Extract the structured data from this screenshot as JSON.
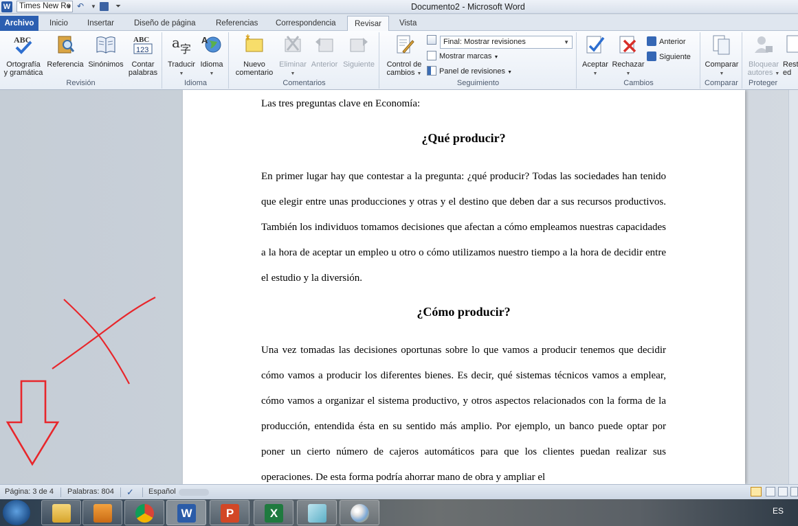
{
  "app": {
    "font_name": "Times New Ro",
    "window_title": "Documento2 - Microsoft Word"
  },
  "tabs": [
    {
      "label": "Archivo"
    },
    {
      "label": "Inicio"
    },
    {
      "label": "Insertar"
    },
    {
      "label": "Diseño de página"
    },
    {
      "label": "Referencias"
    },
    {
      "label": "Correspondencia"
    },
    {
      "label": "Revisar"
    },
    {
      "label": "Vista"
    }
  ],
  "active_tab": "Revisar",
  "ribbon": {
    "revision": {
      "label": "Revisión",
      "ortografia_1": "Ortografía",
      "ortografia_2": "y gramática",
      "referencia": "Referencia",
      "sinonimos": "Sinónimos",
      "contar_1": "Contar",
      "contar_2": "palabras"
    },
    "idioma": {
      "label": "Idioma",
      "traducir": "Traducir",
      "idioma": "Idioma"
    },
    "comentarios": {
      "label": "Comentarios",
      "nuevo_1": "Nuevo",
      "nuevo_2": "comentario",
      "eliminar": "Eliminar",
      "anterior": "Anterior",
      "siguiente": "Siguiente"
    },
    "seguimiento": {
      "label": "Seguimiento",
      "control_1": "Control de",
      "control_2": "cambios",
      "markup_select": "Final: Mostrar revisiones",
      "mostrar_marcas": "Mostrar marcas",
      "panel_revisiones": "Panel de revisiones"
    },
    "cambios": {
      "label": "Cambios",
      "aceptar": "Aceptar",
      "rechazar": "Rechazar",
      "anterior": "Anterior",
      "siguiente": "Siguiente"
    },
    "comparar": {
      "label": "Comparar",
      "comparar": "Comparar"
    },
    "proteger": {
      "label": "Proteger",
      "bloquear_1": "Bloquear",
      "bloquear_2": "autores",
      "restringir_1": "Rest",
      "restringir_2": "ed"
    }
  },
  "document": {
    "intro": "Las tres preguntas clave en Economía:",
    "heading1": "¿Qué producir?",
    "para1": "En primer lugar hay que contestar a la pregunta: ¿qué producir? Todas las sociedades han tenido que elegir entre unas producciones y otras y el destino que deben dar a sus recursos productivos. También los individuos tomamos decisiones que afectan a cómo empleamos nuestras capacidades a la hora de aceptar un empleo u otro o cómo utilizamos nuestro tiempo a la hora de decidir entre el estudio y la diversión.",
    "heading2": "¿Cómo producir?",
    "para2": "Una vez tomadas las decisiones oportunas sobre lo que vamos a producir tenemos que decidir cómo vamos a producir los diferentes bienes. Es decir, qué sistemas técnicos vamos a emplear, cómo vamos a organizar el sistema productivo, y otros aspectos relacionados con la forma de la producción, entendida ésta en su sentido más amplio. Por ejemplo, un banco puede optar por poner un cierto número de cajeros automáticos para que los clientes puedan realizar sus operaciones. De esta forma podría ahorrar mano de obra y ampliar el"
  },
  "status": {
    "page": "Página: 3 de 4",
    "words": "Palabras: 804",
    "language": "Español"
  },
  "taskbar": {
    "language": "ES",
    "icons": [
      "windows-start-icon",
      "file-explorer-icon",
      "media-player-icon",
      "chrome-icon",
      "word-icon",
      "powerpoint-icon",
      "excel-icon",
      "window-app-icon",
      "paint-icon"
    ]
  },
  "colors": {
    "annotation_red": "#e8262b",
    "file_tab_blue": "#2c5fb1"
  }
}
